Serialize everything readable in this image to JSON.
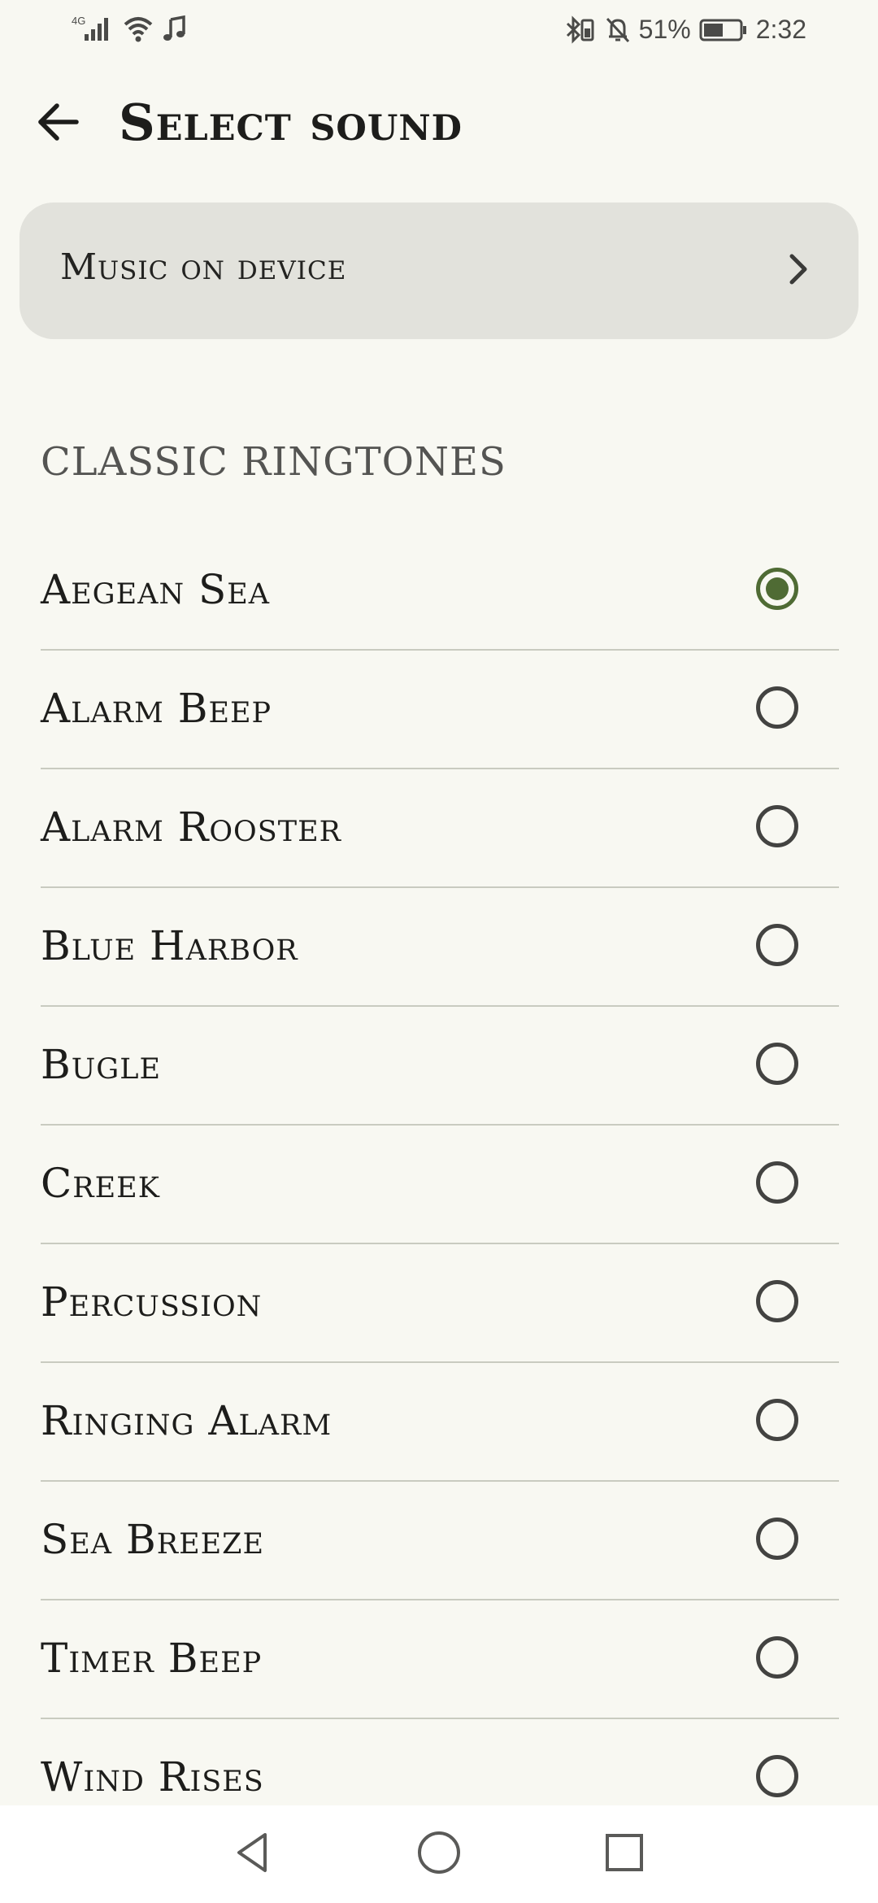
{
  "status_bar": {
    "network": "4G",
    "battery_percent": "51%",
    "time": "2:32",
    "icons": [
      "signal-icon",
      "wifi-icon",
      "music-note-icon",
      "bluetooth-icon",
      "muted-bell-icon",
      "battery-icon"
    ]
  },
  "header": {
    "back_icon": "back-arrow-icon",
    "title": "Select sound"
  },
  "music_on_device": {
    "label": "Music on device",
    "icon": "chevron-right-icon"
  },
  "section": {
    "title": "CLASSIC RINGTONES"
  },
  "ringtones": [
    {
      "label": "Aegean Sea",
      "selected": true
    },
    {
      "label": "Alarm Beep",
      "selected": false
    },
    {
      "label": "Alarm Rooster",
      "selected": false
    },
    {
      "label": "Blue Harbor",
      "selected": false
    },
    {
      "label": "Bugle",
      "selected": false
    },
    {
      "label": "Creek",
      "selected": false
    },
    {
      "label": "Percussion",
      "selected": false
    },
    {
      "label": "Ringing Alarm",
      "selected": false
    },
    {
      "label": "Sea Breeze",
      "selected": false
    },
    {
      "label": "Timer Beep",
      "selected": false
    },
    {
      "label": "Wind Rises",
      "selected": false
    }
  ],
  "nav_bar": {
    "icons": [
      "back-triangle-icon",
      "home-circle-icon",
      "recents-square-icon"
    ]
  },
  "colors": {
    "background": "#f8f8f2",
    "card": "#e2e2dc",
    "accent": "#4f6b34",
    "divider": "#c9cbc0"
  }
}
